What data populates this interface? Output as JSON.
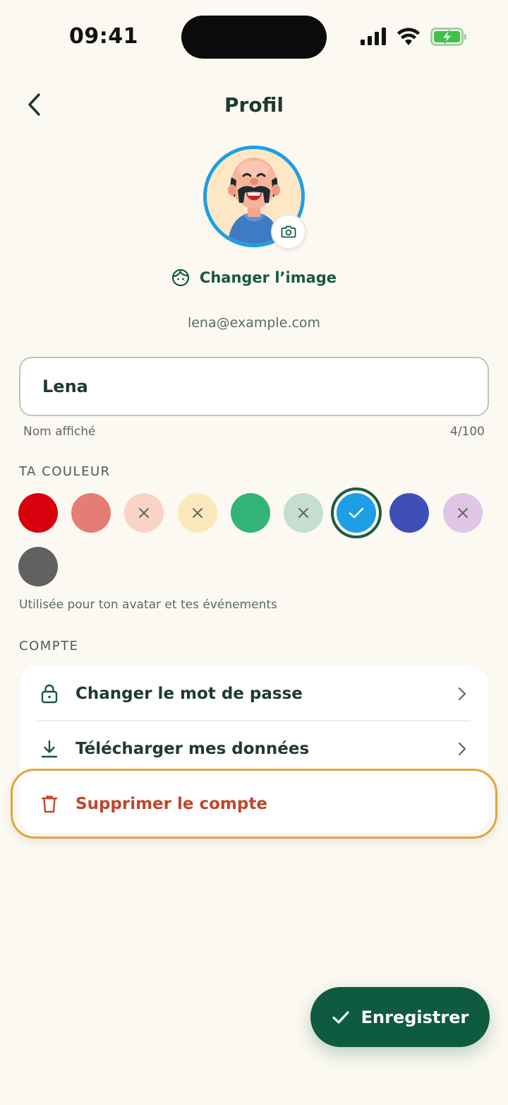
{
  "status_bar": {
    "time": "09:41"
  },
  "header": {
    "title": "Profil"
  },
  "profile": {
    "change_image_label": "Changer l’image",
    "email": "lena@example.com"
  },
  "name_field": {
    "value": "Lena",
    "helper": "Nom affiché",
    "counter": "4/100"
  },
  "color_section": {
    "label": "TA COULEUR",
    "hint": "Utilisée pour ton avatar et tes événements",
    "swatches": [
      {
        "color": "#d9000d",
        "state": "available"
      },
      {
        "color": "#e57d75",
        "state": "available"
      },
      {
        "color": "#f9d4c5",
        "state": "unavailable"
      },
      {
        "color": "#fbe9bd",
        "state": "unavailable"
      },
      {
        "color": "#32b478",
        "state": "available"
      },
      {
        "color": "#c4dfd0",
        "state": "unavailable"
      },
      {
        "color": "#1c9fe6",
        "state": "selected"
      },
      {
        "color": "#3f4fb8",
        "state": "available"
      },
      {
        "color": "#e0c6e6",
        "state": "unavailable"
      },
      {
        "color": "#616161",
        "state": "available"
      }
    ]
  },
  "account_section": {
    "label": "COMPTE",
    "items": [
      {
        "label": "Changer le mot de passe",
        "icon": "lock-icon"
      },
      {
        "label": "Télécharger mes données",
        "icon": "download-icon"
      },
      {
        "label": "Supprimer le compte",
        "icon": "trash-icon"
      }
    ]
  },
  "save_button": {
    "label": "Enregistrer"
  },
  "colors": {
    "accent": "#0e5b3f",
    "danger": "#c0472c",
    "highlight": "#e2a43a",
    "background": "#fbf9f1"
  }
}
